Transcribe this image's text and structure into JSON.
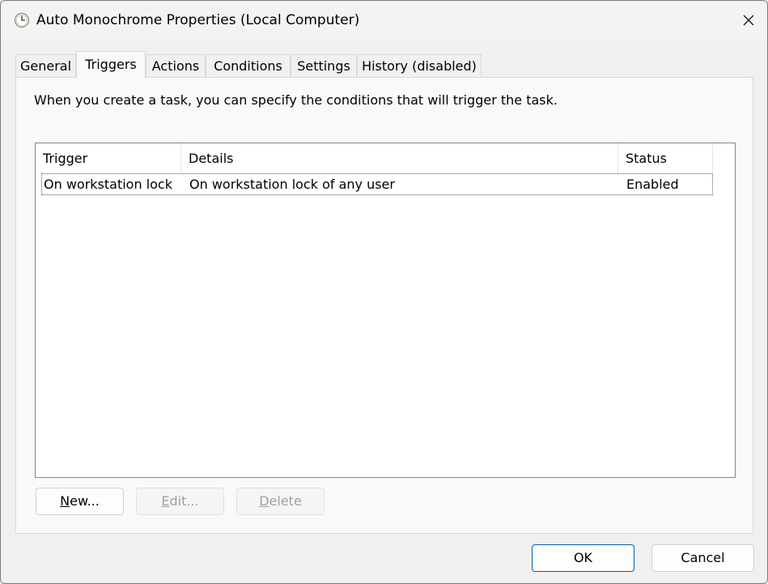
{
  "window": {
    "title": "Auto Monochrome Properties (Local Computer)",
    "icon": "clock-icon"
  },
  "tabs": [
    {
      "label": "General",
      "active": false
    },
    {
      "label": "Triggers",
      "active": true
    },
    {
      "label": "Actions",
      "active": false
    },
    {
      "label": "Conditions",
      "active": false
    },
    {
      "label": "Settings",
      "active": false
    },
    {
      "label": "History (disabled)",
      "active": false
    }
  ],
  "triggers_tab": {
    "description": "When you create a task, you can specify the conditions that will trigger the task.",
    "columns": [
      "Trigger",
      "Details",
      "Status"
    ],
    "rows": [
      {
        "trigger": "On workstation lock",
        "details": "On workstation lock of any user",
        "status": "Enabled"
      }
    ],
    "buttons": {
      "new": {
        "mnemonic": "N",
        "rest": "ew..."
      },
      "edit": {
        "mnemonic": "E",
        "rest": "dit..."
      },
      "delete": {
        "mnemonic": "D",
        "rest": "elete"
      }
    }
  },
  "footer": {
    "ok_label": "OK",
    "cancel_label": "Cancel"
  },
  "colors": {
    "accent": "#005fb8",
    "disabled_text": "#a0a0a0"
  }
}
